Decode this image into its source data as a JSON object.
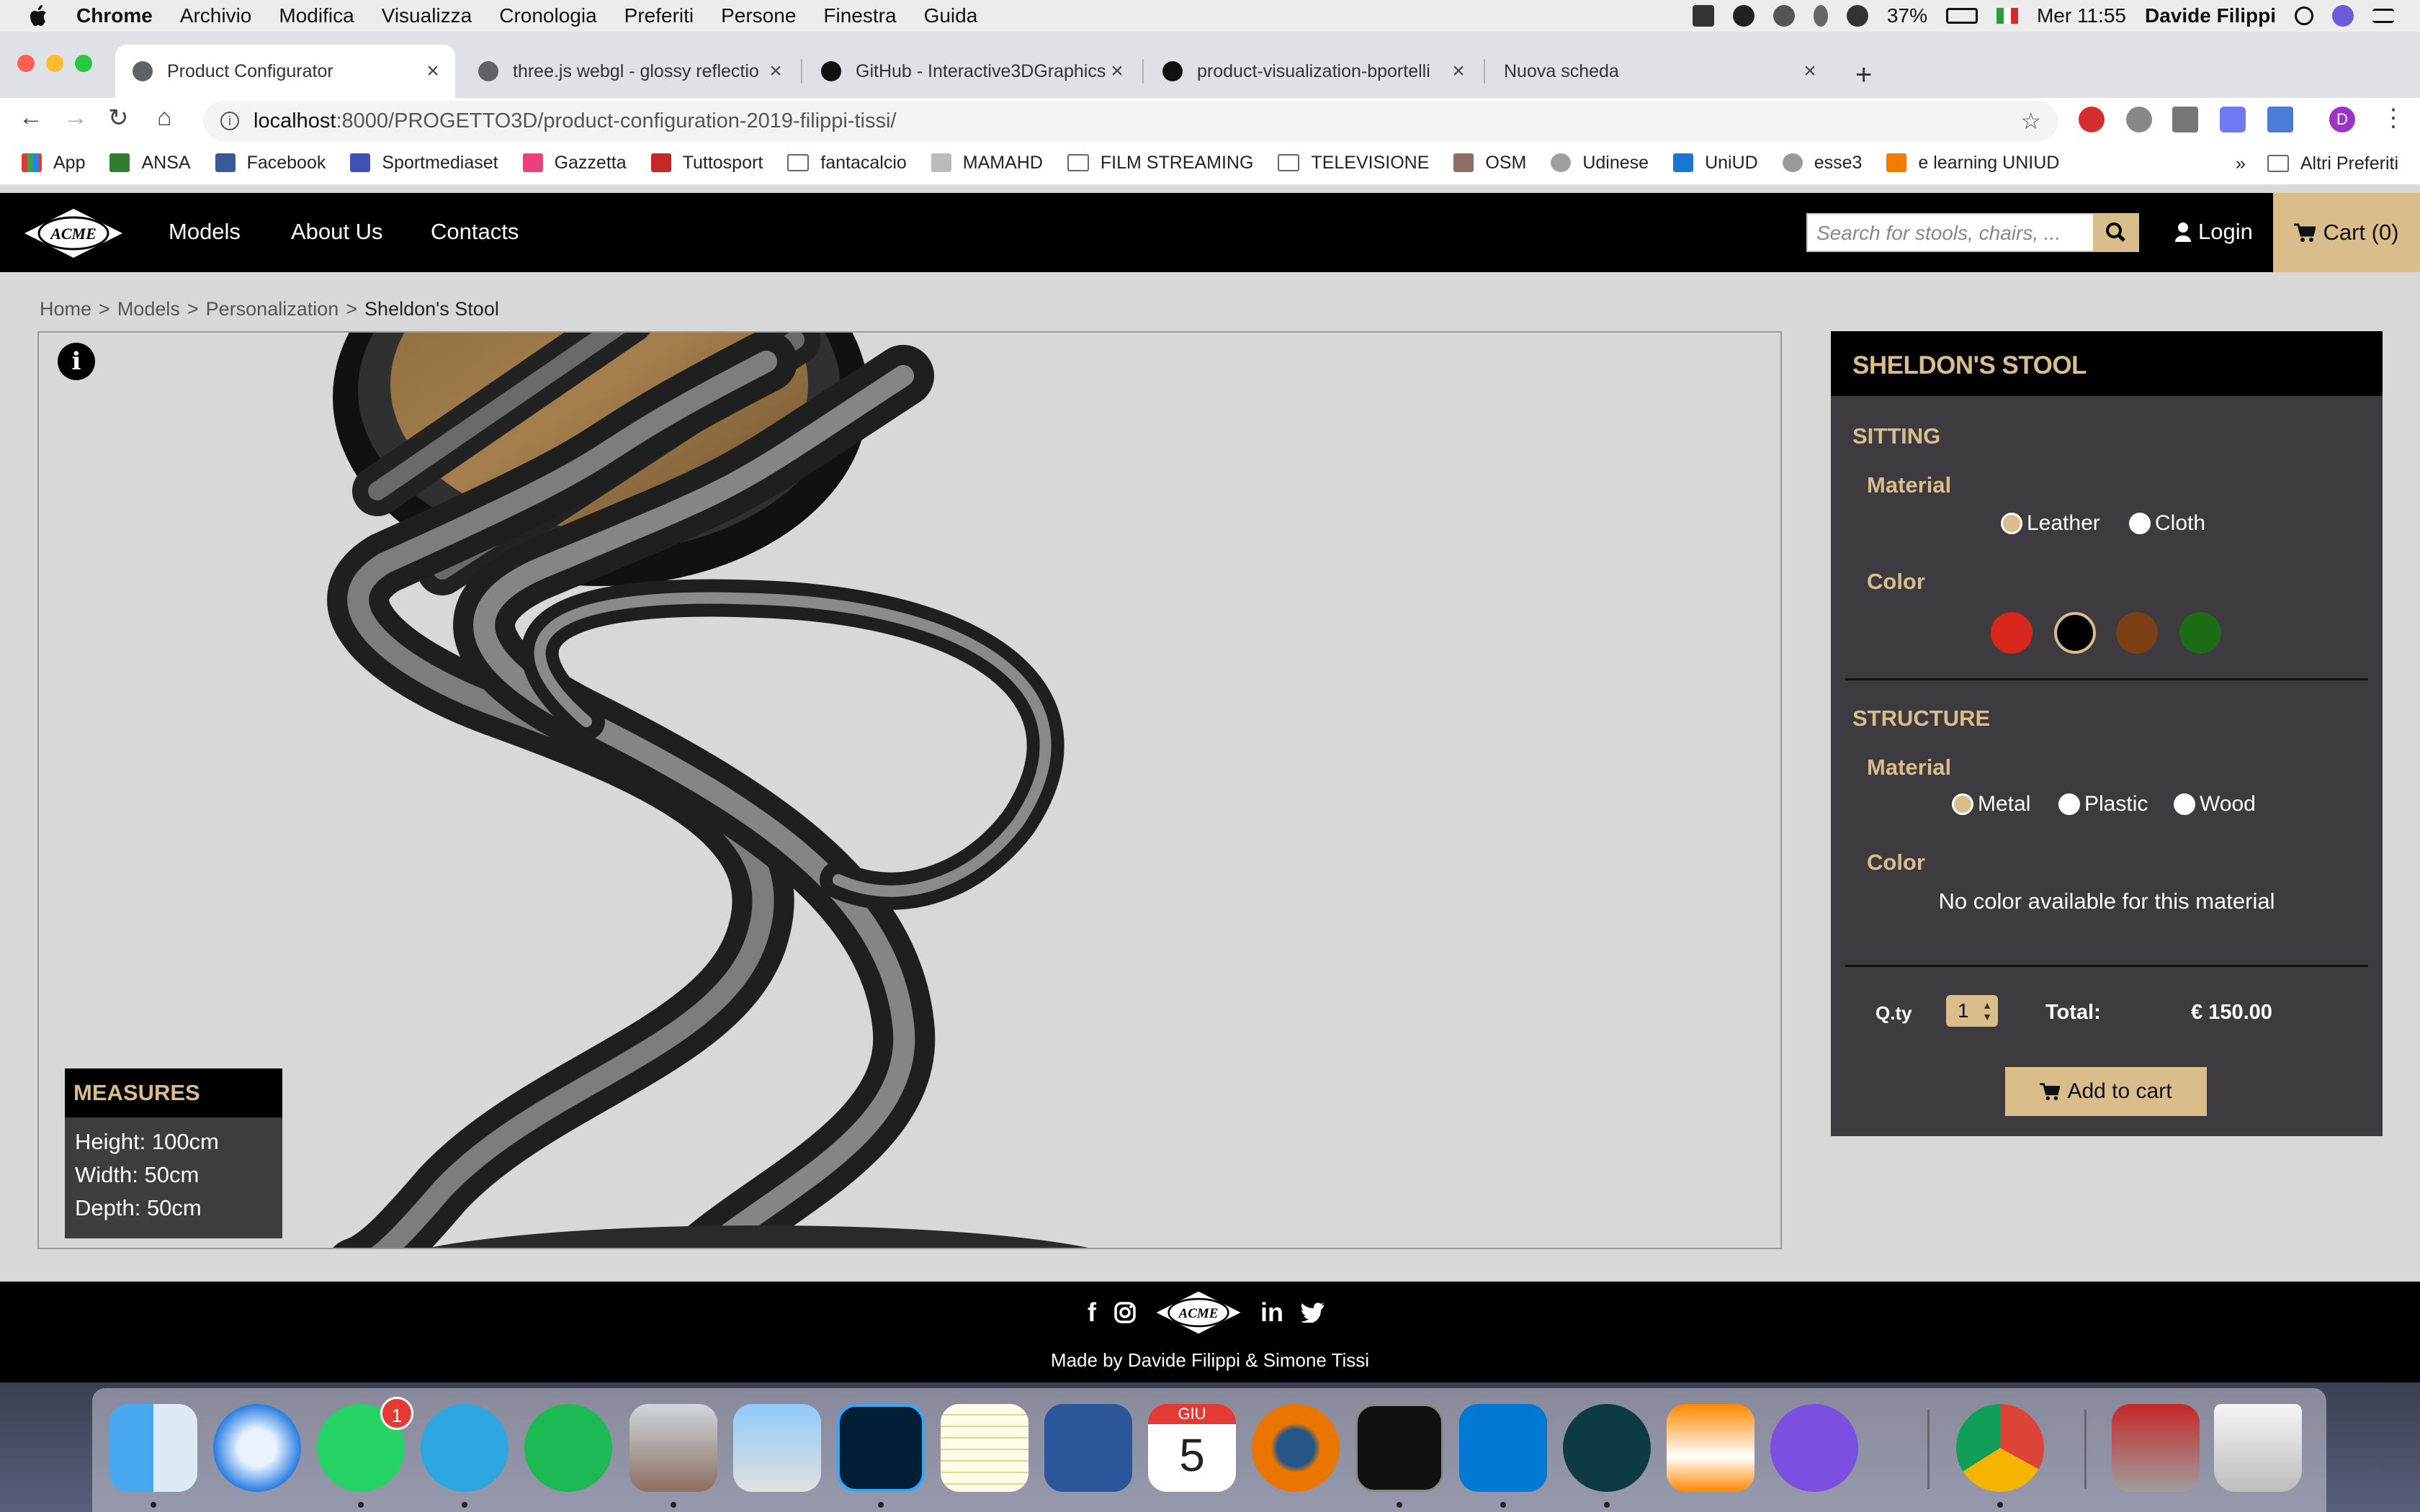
{
  "menubar": {
    "app": "Chrome",
    "items": [
      "Archivio",
      "Modifica",
      "Visualizza",
      "Cronologia",
      "Preferiti",
      "Persone",
      "Finestra",
      "Guida"
    ],
    "battery": "37%",
    "clock": "Mer 11:55",
    "user": "Davide Filippi"
  },
  "browser": {
    "tabs": [
      {
        "title": "Product Configurator"
      },
      {
        "title": "three.js webgl - glossy reflectio"
      },
      {
        "title": "GitHub - Interactive3DGraphics"
      },
      {
        "title": "product-visualization-bportelli"
      },
      {
        "title": "Nuova scheda"
      }
    ],
    "url_host": "localhost",
    "url_path": ":8000/PROGETTO3D/product-configuration-2019-filippi-tissi/",
    "avatar_letter": "D",
    "bookmarks": [
      "App",
      "ANSA",
      "Facebook",
      "Sportmediaset",
      "Gazzetta",
      "Tuttosport",
      "fantacalcio",
      "MAMAHD",
      "FILM STREAMING",
      "TELEVISIONE",
      "OSM",
      "Udinese",
      "UniUD",
      "esse3",
      "e learning UNIUD"
    ],
    "bookmarks_more": "»",
    "other_bookmarks": "Altri Preferiti"
  },
  "site": {
    "logo_text": "ACME",
    "nav": [
      "Models",
      "About Us",
      "Contacts"
    ],
    "search_placeholder": "Search for stools, chairs, ...",
    "login": "Login",
    "cart": "Cart (0)"
  },
  "breadcrumb": {
    "items": [
      "Home",
      "Models",
      "Personalization"
    ],
    "separator": ">",
    "current": "Sheldon's Stool"
  },
  "viewer": {
    "info_glyph": "i",
    "measures_title": "MEASURES",
    "measures": [
      "Height: 100cm",
      "Width: 50cm",
      "Depth: 50cm"
    ]
  },
  "config": {
    "product_name": "SHELDON'S STOOL",
    "sitting": {
      "title": "SITTING",
      "material_label": "Material",
      "materials": [
        {
          "label": "Leather",
          "selected": true
        },
        {
          "label": "Cloth",
          "selected": false
        }
      ],
      "color_label": "Color",
      "colors": [
        {
          "name": "red",
          "hex": "#d8271d",
          "selected": false
        },
        {
          "name": "black",
          "hex": "#000000",
          "selected": true
        },
        {
          "name": "brown",
          "hex": "#7b3f16",
          "selected": false
        },
        {
          "name": "green",
          "hex": "#1e6b17",
          "selected": false
        }
      ]
    },
    "structure": {
      "title": "STRUCTURE",
      "material_label": "Material",
      "materials": [
        {
          "label": "Metal",
          "selected": true
        },
        {
          "label": "Plastic",
          "selected": false
        },
        {
          "label": "Wood",
          "selected": false
        }
      ],
      "color_label": "Color",
      "no_color": "No color available for this material"
    },
    "qty_label": "Q.ty",
    "qty_value": "1",
    "total_label": "Total:",
    "total_value": "€ 150.00",
    "add_to_cart": "Add to cart"
  },
  "footer": {
    "credits": "Made by Davide Filippi & Simone Tissi",
    "social_icons": [
      "facebook-icon",
      "instagram-icon",
      "linkedin-icon",
      "twitter-icon"
    ],
    "facebook_glyph": "f",
    "linkedin_glyph": "in"
  },
  "dock": {
    "whatsapp_badge": "1",
    "calendar_month": "GIU",
    "calendar_day": "5"
  },
  "theme": {
    "accent": "#d9bd8a",
    "panel_bg": "#3d3b40",
    "header_bg": "#000000"
  }
}
